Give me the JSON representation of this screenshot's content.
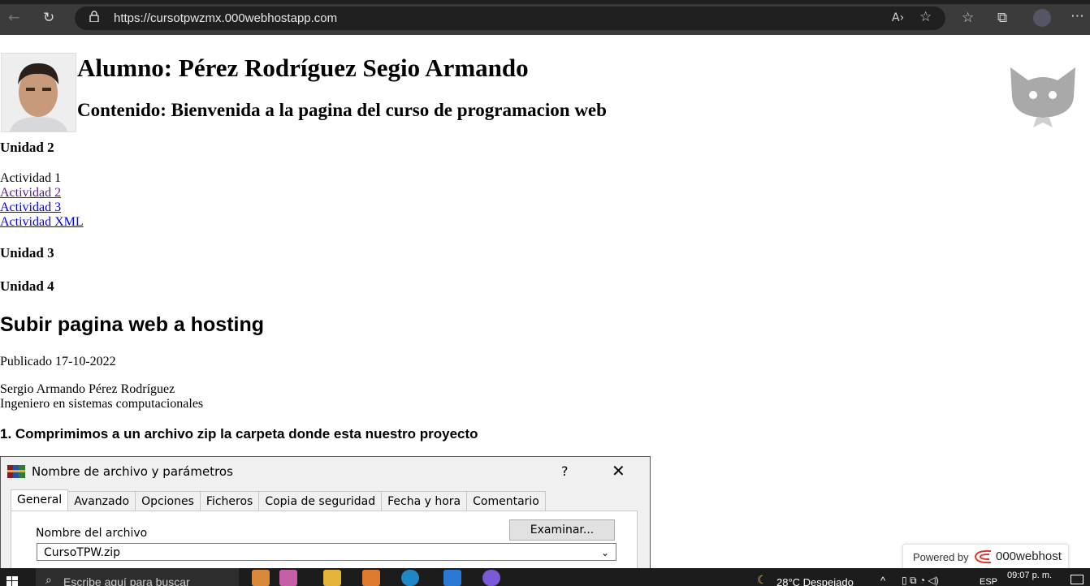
{
  "browser": {
    "url": "https://cursotpwzmx.000webhostapp.com",
    "icons": [
      "back-icon",
      "refresh-icon",
      "lock-icon",
      "read-aloud-icon",
      "add-favorite-icon",
      "favorites-icon",
      "collections-icon",
      "profile-avatar",
      "more-icon"
    ]
  },
  "header": {
    "student": "Alumno: Pérez Rodríguez Segio Armando",
    "content": "Contenido: Bienvenida a la pagina del curso de programacion web"
  },
  "units": {
    "unit2": "Unidad 2",
    "activities": [
      {
        "label": "Actividad 1",
        "linked": false
      },
      {
        "label": "Actividad 2",
        "linked": true,
        "visited": true
      },
      {
        "label": "Actividad 3",
        "linked": true,
        "visited": false
      },
      {
        "label": "Actividad XML",
        "linked": true,
        "visited": false
      }
    ],
    "unit3": "Unidad 3",
    "unit4": "Unidad 4"
  },
  "post": {
    "title": "Subir pagina web a hosting",
    "published": "Publicado 17-10-2022",
    "author": "Sergio Armando Pérez Rodríguez",
    "role": "Ingeniero en sistemas computacionales",
    "step1": "1. Comprimimos a un archivo zip la carpeta donde esta nuestro proyecto"
  },
  "dialog": {
    "title": "Nombre de archivo y parámetros",
    "help": "?",
    "close": "✕",
    "tabs": [
      "General",
      "Avanzado",
      "Opciones",
      "Ficheros",
      "Copia de seguridad",
      "Fecha y hora",
      "Comentario"
    ],
    "active_tab": "General",
    "filename_label": "Nombre del archivo",
    "browse_label": "Examinar...",
    "filename_value": "CursoTPW.zip"
  },
  "powered": {
    "text": "Powered by",
    "brand": "000webhost"
  },
  "taskbar": {
    "search_placeholder": "Escribe aquí para buscar",
    "weather": "28°C  Despejado",
    "language": "ESP",
    "time": "09:07 p. m."
  }
}
